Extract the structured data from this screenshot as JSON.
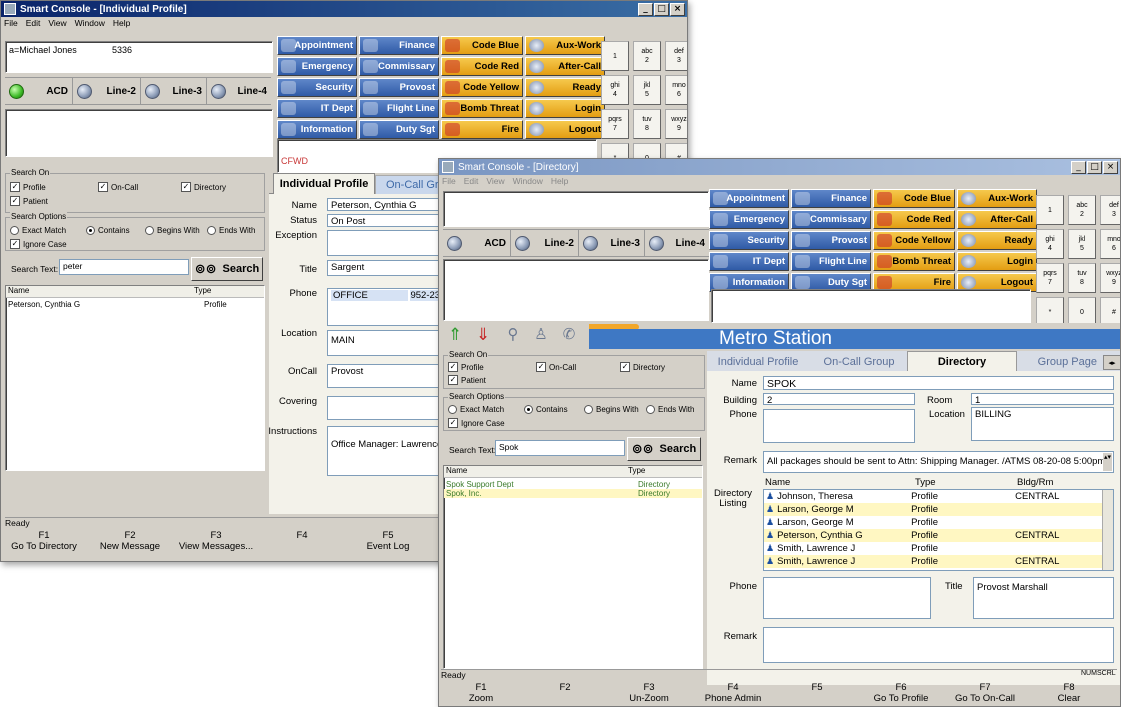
{
  "window1": {
    "title": "Smart Console - [Individual Profile]",
    "menu": [
      "File",
      "Edit",
      "View",
      "Window",
      "Help"
    ],
    "caller_name": "a=Michael Jones",
    "caller_ext": "5336",
    "lines": [
      "ACD",
      "Line-2",
      "Line-3",
      "Line-4"
    ],
    "cfwd": "CFWD",
    "search_on": {
      "title": "Search On",
      "profile": "Profile",
      "oncall": "On-Call",
      "directory": "Directory",
      "patient": "Patient"
    },
    "search_options": {
      "title": "Search Options",
      "exact": "Exact Match",
      "contains": "Contains",
      "begins": "Begins With",
      "ends": "Ends With",
      "ignore": "Ignore Case"
    },
    "search_text_label": "Search Text:",
    "search_text_value": "peter",
    "search_button": "Search",
    "results_headers": [
      "Name",
      "Type"
    ],
    "results": [
      {
        "name": "Peterson, Cynthia G",
        "type": "Profile"
      }
    ],
    "tabs": [
      "Individual Profile",
      "On-Call Gr"
    ],
    "profile": {
      "name_label": "Name",
      "name": "Peterson, Cynthia G",
      "status_label": "Status",
      "status": "On Post",
      "exception_label": "Exception",
      "title_label": "Title",
      "title": "Sargent",
      "phone_label": "Phone",
      "phone_type": "OFFICE",
      "phone_num": "952-230-00",
      "location_label": "Location",
      "location": "MAIN",
      "oncall_label": "OnCall",
      "oncall": "Provost",
      "covering_label": "Covering",
      "instructions_label": "Instructions",
      "instructions": "Office Manager: Lawrence S"
    },
    "status": "Ready",
    "fkeys": [
      {
        "k": "F1",
        "l": "Go To Directory"
      },
      {
        "k": "F2",
        "l": "New Message"
      },
      {
        "k": "F3",
        "l": "View Messages..."
      },
      {
        "k": "F4",
        "l": ""
      },
      {
        "k": "F5",
        "l": "Event Log"
      },
      {
        "k": "",
        "l": "G"
      }
    ]
  },
  "quick_buttons": [
    [
      {
        "l": "Appointment",
        "c": "blue"
      },
      {
        "l": "Finance",
        "c": "blue"
      },
      {
        "l": "Code Blue",
        "c": "gold"
      },
      {
        "l": "Aux-Work",
        "c": "gold"
      }
    ],
    [
      {
        "l": "Emergency",
        "c": "blue"
      },
      {
        "l": "Commissary",
        "c": "blue"
      },
      {
        "l": "Code Red",
        "c": "gold"
      },
      {
        "l": "After-Call",
        "c": "gold"
      }
    ],
    [
      {
        "l": "Security",
        "c": "blue"
      },
      {
        "l": "Provost",
        "c": "blue"
      },
      {
        "l": "Code Yellow",
        "c": "gold"
      },
      {
        "l": "Ready",
        "c": "gold"
      }
    ],
    [
      {
        "l": "IT Dept",
        "c": "blue"
      },
      {
        "l": "Flight Line",
        "c": "blue"
      },
      {
        "l": "Bomb Threat",
        "c": "gold"
      },
      {
        "l": "Login",
        "c": "gold"
      }
    ],
    [
      {
        "l": "Information",
        "c": "blue"
      },
      {
        "l": "Duty Sgt",
        "c": "blue"
      },
      {
        "l": "Fire",
        "c": "gold"
      },
      {
        "l": "Logout",
        "c": "gold"
      }
    ]
  ],
  "keypad": [
    {
      "d": "1",
      "t": ""
    },
    {
      "d": "2",
      "t": "abc"
    },
    {
      "d": "3",
      "t": "def"
    },
    {
      "d": "4",
      "t": "ghi"
    },
    {
      "d": "5",
      "t": "jkl"
    },
    {
      "d": "6",
      "t": "mno"
    },
    {
      "d": "7",
      "t": "pqrs"
    },
    {
      "d": "8",
      "t": "tuv"
    },
    {
      "d": "9",
      "t": "wxyz"
    },
    {
      "d": "*",
      "t": ""
    },
    {
      "d": "0",
      "t": ""
    },
    {
      "d": "#",
      "t": ""
    }
  ],
  "window2": {
    "title": "Smart Console - [Directory]",
    "menu": [
      "File",
      "Edit",
      "View",
      "Window",
      "Help"
    ],
    "lines": [
      "ACD",
      "Line-2",
      "Line-3",
      "Line-4"
    ],
    "banner": "Metro Station",
    "search_on": {
      "title": "Search On",
      "profile": "Profile",
      "oncall": "On-Call",
      "directory": "Directory",
      "patient": "Patient"
    },
    "search_options": {
      "title": "Search Options",
      "exact": "Exact Match",
      "contains": "Contains",
      "begins": "Begins With",
      "ends": "Ends With",
      "ignore": "Ignore Case"
    },
    "search_text_label": "Search Text:",
    "search_text_value": "Spok",
    "search_button": "Search",
    "results_headers": [
      "Name",
      "Type"
    ],
    "results": [
      {
        "name": "Spok Support Dept",
        "type": "Directory"
      },
      {
        "name": "Spok, Inc.",
        "type": "Directory"
      }
    ],
    "tabs": [
      "Individual Profile",
      "On-Call Group",
      "Directory",
      "Group Page"
    ],
    "dir": {
      "name_label": "Name",
      "name": "SPOK",
      "building_label": "Building",
      "building": "2",
      "room_label": "Room",
      "room": "1",
      "phone_label": "Phone",
      "location_label": "Location",
      "location": "BILLING",
      "remark_label": "Remark",
      "remark": "All packages should be sent to Attn: Shipping Manager. /ATMS 08-20-08 5:00pm",
      "listing_label": "Directory Listing",
      "listing_headers": [
        "Name",
        "Type",
        "Bldg/Rm"
      ],
      "listing": [
        {
          "n": "Johnson, Theresa",
          "t": "Profile",
          "b": "CENTRAL"
        },
        {
          "n": "Larson, George M",
          "t": "Profile",
          "b": ""
        },
        {
          "n": "Larson, George M",
          "t": "Profile",
          "b": ""
        },
        {
          "n": "Peterson, Cynthia G",
          "t": "Profile",
          "b": "CENTRAL"
        },
        {
          "n": "Smith, Lawrence J",
          "t": "Profile",
          "b": ""
        },
        {
          "n": "Smith, Lawrence J",
          "t": "Profile",
          "b": "CENTRAL"
        }
      ],
      "phone2_label": "Phone",
      "title_label": "Title",
      "title": "Provost Marshall",
      "remark2_label": "Remark"
    },
    "status": "Ready",
    "status_ind": [
      "NUM",
      "SCRL"
    ],
    "fkeys": [
      {
        "k": "F1",
        "l": "Zoom"
      },
      {
        "k": "F2",
        "l": ""
      },
      {
        "k": "F3",
        "l": "Un-Zoom"
      },
      {
        "k": "F4",
        "l": "Phone Admin"
      },
      {
        "k": "F5",
        "l": ""
      },
      {
        "k": "F6",
        "l": "Go To Profile"
      },
      {
        "k": "F7",
        "l": "Go To On-Call"
      },
      {
        "k": "F8",
        "l": "Clear"
      }
    ]
  }
}
